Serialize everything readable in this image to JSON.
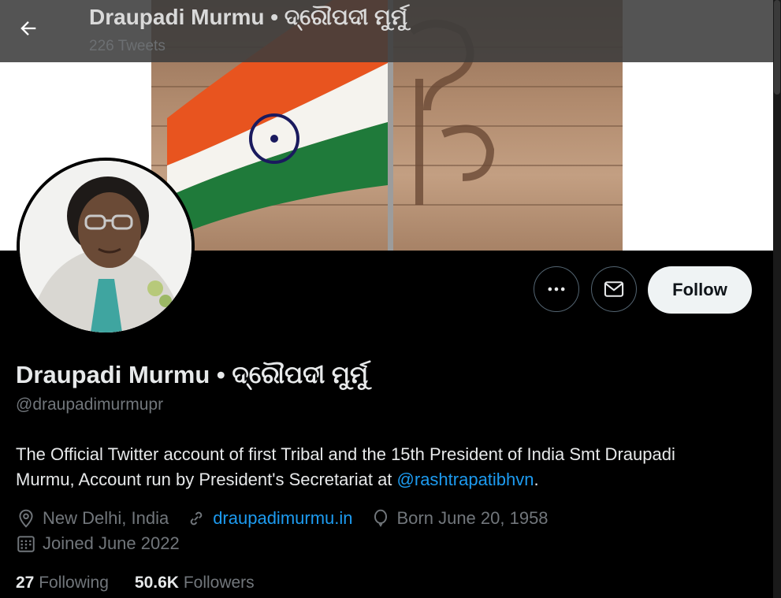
{
  "header": {
    "title": "Draupadi Murmu • ଦ୍ରୌପଦୀ ମୁର୍ମୁ",
    "tweet_count": "226 Tweets"
  },
  "actions": {
    "follow_label": "Follow"
  },
  "profile": {
    "name": "Draupadi Murmu • ଦ୍ରୌପଦୀ ମୁର୍ମୁ",
    "handle": "@draupadimurmupr",
    "bio_text": "The Official Twitter account of first Tribal and the 15th President of India Smt Draupadi Murmu, Account run by President's Secretariat at ",
    "bio_mention": "@rashtrapatibhvn",
    "bio_end": ".",
    "location": "New Delhi, India",
    "website": "draupadimurmu.in",
    "birthday": "Born June 20, 1958",
    "joined": "Joined June 2022"
  },
  "stats": {
    "following_count": "27",
    "following_label": "Following",
    "followers_count": "50.6K",
    "followers_label": "Followers"
  },
  "colors": {
    "accent": "#1d9bf0",
    "background": "#000000",
    "muted_text": "#71767b",
    "follow_button_bg": "#eff3f4"
  },
  "icons": [
    "back-arrow-icon",
    "more-icon",
    "mail-icon",
    "location-icon",
    "link-icon",
    "balloon-icon",
    "calendar-icon"
  ]
}
